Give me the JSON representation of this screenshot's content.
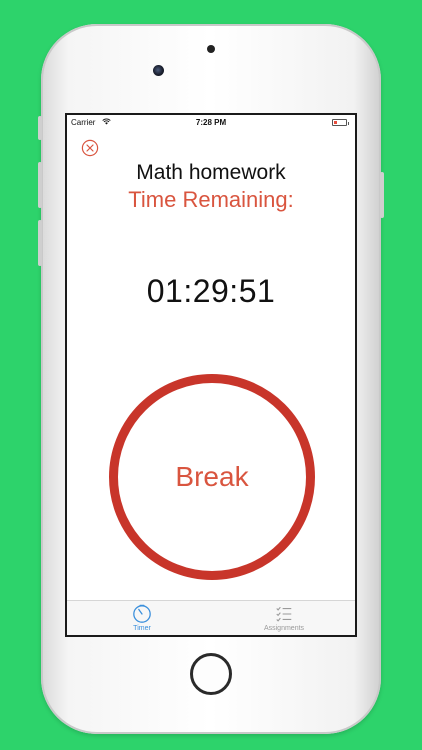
{
  "status_bar": {
    "carrier": "Carrier",
    "time": "7:28 PM",
    "battery_color": "#e74c3c"
  },
  "timer": {
    "close_icon": "close-circle-icon",
    "task_name": "Math homework",
    "remaining_label": "Time Remaining:",
    "countdown": "01:29:51",
    "break_button_label": "Break",
    "accent_color": "#d9553f",
    "ring_color": "#c8352a"
  },
  "tab_bar": {
    "tabs": [
      {
        "label": "Timer",
        "icon": "timer-icon",
        "selected": true
      },
      {
        "label": "Assignments",
        "icon": "checklist-icon",
        "selected": false
      }
    ],
    "selected_color": "#3a8fdc",
    "unselected_color": "#9a9a9a"
  },
  "device": {
    "background_color": "#2dd36b"
  }
}
